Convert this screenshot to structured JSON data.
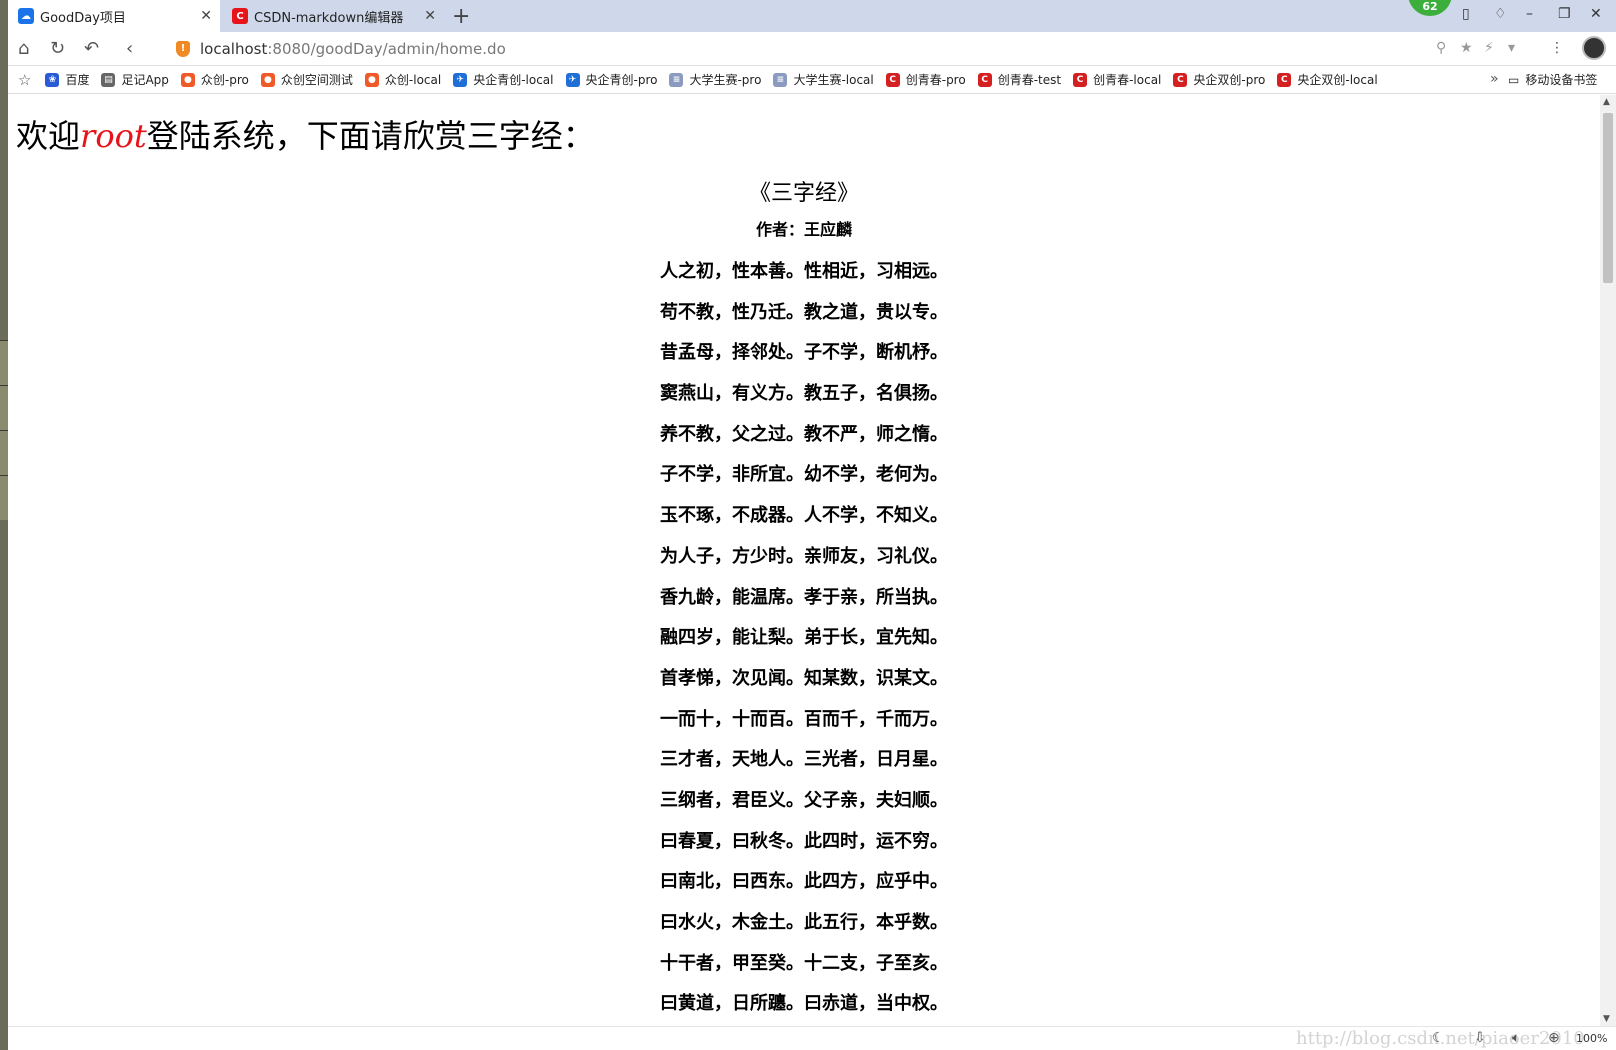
{
  "tabs": [
    {
      "title": "GoodDay项目",
      "active": true,
      "favicon_color": "#1a73e8"
    },
    {
      "title": "CSDN-markdown编辑器",
      "active": false,
      "favicon_color": "#e8141c"
    }
  ],
  "new_tab_symbol": "+",
  "badge_count": "62",
  "address": {
    "host": "localhost",
    "port_path": ":8080/goodDay/admin/home.do"
  },
  "bookmarks": [
    {
      "label": "百度",
      "icon": "paw-icon",
      "color": "#2a5bd7"
    },
    {
      "label": "足记App",
      "icon": "page-icon",
      "color": "#666666"
    },
    {
      "label": "众创-pro",
      "icon": "dots-icon",
      "color": "#f05a28"
    },
    {
      "label": "众创空间测试",
      "icon": "dots-icon",
      "color": "#f05a28"
    },
    {
      "label": "众创-local",
      "icon": "dots-icon",
      "color": "#f05a28"
    },
    {
      "label": "央企青创-local",
      "icon": "globe-icon",
      "color": "#1f6fd6"
    },
    {
      "label": "央企青创-pro",
      "icon": "globe-icon",
      "color": "#1f6fd6"
    },
    {
      "label": "大学生赛-pro",
      "icon": "bars-icon",
      "color": "#8a9bbf"
    },
    {
      "label": "大学生赛-local",
      "icon": "bars-icon",
      "color": "#8a9bbf"
    },
    {
      "label": "创青春-pro",
      "icon": "c-icon",
      "color": "#d42020"
    },
    {
      "label": "创青春-test",
      "icon": "c-icon",
      "color": "#d42020"
    },
    {
      "label": "创青春-local",
      "icon": "c-icon",
      "color": "#d42020"
    },
    {
      "label": "央企双创-pro",
      "icon": "c-icon",
      "color": "#d42020"
    },
    {
      "label": "央企双创-local",
      "icon": "c-icon",
      "color": "#d42020"
    }
  ],
  "bookmarks_more": "»",
  "mobile_bookmarks": "移动设备书签",
  "welcome": {
    "prefix": "欢迎",
    "user": "root",
    "suffix": "登陆系统，下面请欣赏三字经："
  },
  "poem": {
    "title": "《三字经》",
    "author": "作者：王应麟",
    "lines": [
      "人之初，性本善。性相近，习相远。",
      "苟不教，性乃迁。教之道，贵以专。",
      "昔孟母，择邻处。子不学，断机杼。",
      "窦燕山，有义方。教五子，名俱扬。",
      "养不教，父之过。教不严，师之惰。",
      "子不学，非所宜。幼不学，老何为。",
      "玉不琢，不成器。人不学，不知义。",
      "为人子，方少时。亲师友，习礼仪。",
      "香九龄，能温席。孝于亲，所当执。",
      "融四岁，能让梨。弟于长，宜先知。",
      "首孝悌，次见闻。知某数，识某文。",
      "一而十，十而百。百而千，千而万。",
      "三才者，天地人。三光者，日月星。",
      "三纲者，君臣义。父子亲，夫妇顺。",
      "曰春夏，曰秋冬。此四时，运不穷。",
      "曰南北，曰西东。此四方，应乎中。",
      "曰水火，木金土。此五行，本乎数。",
      "十干者，甲至癸。十二支，子至亥。",
      "曰黄道，日所躔。曰赤道，当中权。"
    ]
  },
  "watermark": "http://blog.csdn.net/piaoer2010",
  "zoom": "100%"
}
